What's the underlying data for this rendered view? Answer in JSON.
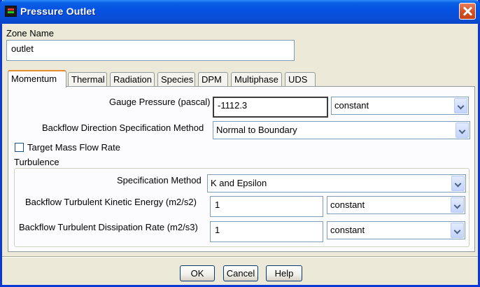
{
  "window": {
    "title": "Pressure Outlet"
  },
  "zone": {
    "label": "Zone Name",
    "value": "outlet"
  },
  "tabs": [
    {
      "label": "Momentum",
      "active": true
    },
    {
      "label": "Thermal"
    },
    {
      "label": "Radiation"
    },
    {
      "label": "Species"
    },
    {
      "label": "DPM"
    },
    {
      "label": "Multiphase"
    },
    {
      "label": "UDS"
    }
  ],
  "momentum": {
    "gauge_pressure": {
      "label": "Gauge Pressure (pascal)",
      "value": "-1112.3",
      "method": "constant"
    },
    "backflow_direction": {
      "label": "Backflow Direction Specification Method",
      "value": "Normal to Boundary"
    },
    "target_mass_flow": {
      "label": "Target Mass Flow Rate",
      "checked": false
    }
  },
  "turbulence": {
    "group_label": "Turbulence",
    "spec_method": {
      "label": "Specification Method",
      "value": "K and Epsilon"
    },
    "kinetic_energy": {
      "label": "Backflow Turbulent Kinetic Energy (m2/s2)",
      "value": "1",
      "method": "constant"
    },
    "dissipation_rate": {
      "label": "Backflow Turbulent Dissipation Rate (m2/s3)",
      "value": "1",
      "method": "constant"
    }
  },
  "buttons": {
    "ok": "OK",
    "cancel": "Cancel",
    "help": "Help"
  },
  "colors": {
    "title_bar": "#0453e1",
    "close_button": "#d64d22",
    "active_tab_accent": "#e68b2c",
    "dialog_bg": "#ece9d8"
  },
  "icons": {
    "app": "fluent-app-icon",
    "close": "close-icon",
    "dropdown": "chevron-down-icon"
  }
}
